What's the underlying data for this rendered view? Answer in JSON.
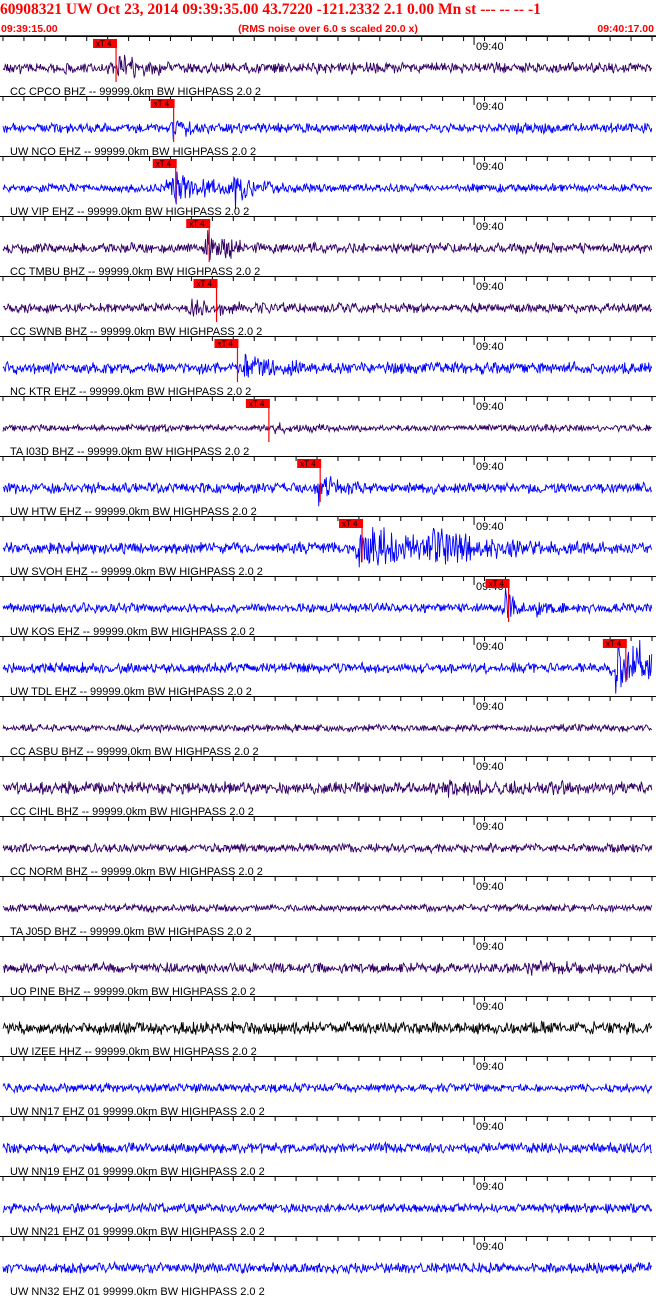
{
  "header": {
    "title": "60908321 UW Oct 23, 2014 09:39:35.00   43.7220 -121.2332  2.1 0.00 Mn st --- -- --  -1",
    "start_time": "09:39:15.00",
    "rms_note": "(RMS noise over 6.0 s scaled 20.0 x)",
    "end_time": "09:40:17.00"
  },
  "colors": {
    "header_text": "#ff0000",
    "pick": "#ff0000",
    "pick_label_text": "#000000",
    "trace_blue": "#0000ff",
    "trace_purple": "#330066",
    "trace_black": "#000000"
  },
  "chart_data": {
    "type": "line",
    "title": "",
    "xlabel": "",
    "ylabel": "",
    "xlim": [
      "09:39:15.00",
      "09:40:17.00"
    ],
    "tick_interval_s": 2,
    "minute_label": "09:40",
    "pick_label": "xT 4",
    "series": [
      {
        "name": "CC CPCO BHZ -- 99999.0km BW  HIGHPASS  2.0  2",
        "color": "#330066",
        "amp": 0.32,
        "pick_s": 10.8,
        "burst": [
          {
            "t": 11.0,
            "a": 0.55,
            "d": 2.0
          }
        ]
      },
      {
        "name": "UW NCO EHZ -- 99999.0km BW  HIGHPASS  2.0  2",
        "color": "#0000ff",
        "amp": 0.28,
        "pick_s": 16.3,
        "burst": [
          {
            "t": 16.0,
            "a": 0.5,
            "d": 2.0
          },
          {
            "t": 49.0,
            "a": 0.3,
            "d": 1.0
          }
        ]
      },
      {
        "name": "UW VIP EHZ -- 99999.0km BW  HIGHPASS  2.0  2",
        "color": "#0000ff",
        "amp": 0.25,
        "pick_s": 16.5,
        "burst": [
          {
            "t": 16.0,
            "a": 1.2,
            "d": 2.5
          },
          {
            "t": 22.0,
            "a": 0.9,
            "d": 1.5
          }
        ]
      },
      {
        "name": "CC TMBU BHZ -- 99999.0km BW  HIGHPASS  2.0  2",
        "color": "#330066",
        "amp": 0.3,
        "pick_s": 19.7,
        "burst": [
          {
            "t": 19.3,
            "a": 1.0,
            "d": 1.2
          },
          {
            "t": 21.0,
            "a": 0.7,
            "d": 0.8
          }
        ]
      },
      {
        "name": "CC SWNB BHZ -- 99999.0km BW  HIGHPASS  2.0  2",
        "color": "#330066",
        "amp": 0.28,
        "pick_s": 20.4,
        "burst": [
          {
            "t": 18.0,
            "a": 0.45,
            "d": 3.0
          }
        ]
      },
      {
        "name": "NC KTR EHZ -- 99999.0km BW  HIGHPASS  2.0  2",
        "color": "#0000ff",
        "amp": 0.34,
        "pick_s": 22.4,
        "burst": [
          {
            "t": 23.0,
            "a": 0.5,
            "d": 3.0
          }
        ]
      },
      {
        "name": "TA I03D BHZ -- 99999.0km BW  HIGHPASS  2.0  2",
        "color": "#330066",
        "amp": 0.2,
        "pick_s": 25.4,
        "burst": [
          {
            "t": 26.0,
            "a": 0.25,
            "d": 2.0
          }
        ]
      },
      {
        "name": "UW HTW EHZ -- 99999.0km BW  HIGHPASS  2.0  2",
        "color": "#0000ff",
        "amp": 0.32,
        "pick_s": 30.3,
        "burst": [
          {
            "t": 30.0,
            "a": 0.9,
            "d": 1.5
          }
        ]
      },
      {
        "name": "UW SVOH EHZ -- 99999.0km BW  HIGHPASS  2.0  2",
        "color": "#0000ff",
        "amp": 0.35,
        "pick_s": 34.3,
        "burst": [
          {
            "t": 34.0,
            "a": 1.3,
            "d": 5.0
          },
          {
            "t": 41.0,
            "a": 0.8,
            "d": 4.0
          }
        ]
      },
      {
        "name": "UW KOS EHZ -- 99999.0km BW  HIGHPASS  2.0  2",
        "color": "#0000ff",
        "amp": 0.28,
        "pick_s": 48.3,
        "burst": [
          {
            "t": 48.0,
            "a": 1.0,
            "d": 0.8
          },
          {
            "t": 51.0,
            "a": 0.4,
            "d": 1.5
          }
        ]
      },
      {
        "name": "UW TDL EHZ -- 99999.0km BW  HIGHPASS  2.0  2",
        "color": "#0000ff",
        "amp": 0.3,
        "pick_s": 59.5,
        "burst": [
          {
            "t": 58.5,
            "a": 1.3,
            "d": 2.5
          },
          {
            "t": 60.5,
            "a": 1.6,
            "d": 1.0
          }
        ]
      },
      {
        "name": "CC ASBU BHZ -- 99999.0km BW  HIGHPASS  2.0  2",
        "color": "#330066",
        "amp": 0.22,
        "pick_s": null,
        "burst": []
      },
      {
        "name": "CC CIHL BHZ -- 99999.0km BW  HIGHPASS  2.0  2",
        "color": "#330066",
        "amp": 0.36,
        "pick_s": null,
        "burst": [
          {
            "t": 42.0,
            "a": 0.25,
            "d": 6.0
          }
        ]
      },
      {
        "name": "CC NORM BHZ -- 99999.0km BW  HIGHPASS  2.0  2",
        "color": "#330066",
        "amp": 0.26,
        "pick_s": null,
        "burst": []
      },
      {
        "name": "TA J05D BHZ -- 99999.0km BW  HIGHPASS  2.0  2",
        "color": "#330066",
        "amp": 0.22,
        "pick_s": null,
        "burst": []
      },
      {
        "name": "UO PINE BHZ -- 99999.0km BW  HIGHPASS  2.0  2",
        "color": "#330066",
        "amp": 0.3,
        "pick_s": null,
        "burst": [
          {
            "t": 50.0,
            "a": 0.2,
            "d": 4.0
          }
        ]
      },
      {
        "name": "UW IZEE HHZ -- 99999.0km BW  HIGHPASS  2.0  2",
        "color": "#000000",
        "amp": 0.36,
        "pick_s": null,
        "burst": []
      },
      {
        "name": "UW NN17 EHZ 01 99999.0km BW  HIGHPASS  2.0  2",
        "color": "#0000ff",
        "amp": 0.26,
        "pick_s": null,
        "burst": []
      },
      {
        "name": "UW NN19 EHZ 01 99999.0km BW  HIGHPASS  2.0  2",
        "color": "#0000ff",
        "amp": 0.3,
        "pick_s": null,
        "burst": []
      },
      {
        "name": "UW NN21 EHZ 01 99999.0km BW  HIGHPASS  2.0  2",
        "color": "#0000ff",
        "amp": 0.28,
        "pick_s": null,
        "burst": []
      },
      {
        "name": "UW NN32 EHZ 01 99999.0km BW  HIGHPASS  2.0  2",
        "color": "#0000ff",
        "amp": 0.3,
        "pick_s": null,
        "burst": []
      }
    ]
  }
}
